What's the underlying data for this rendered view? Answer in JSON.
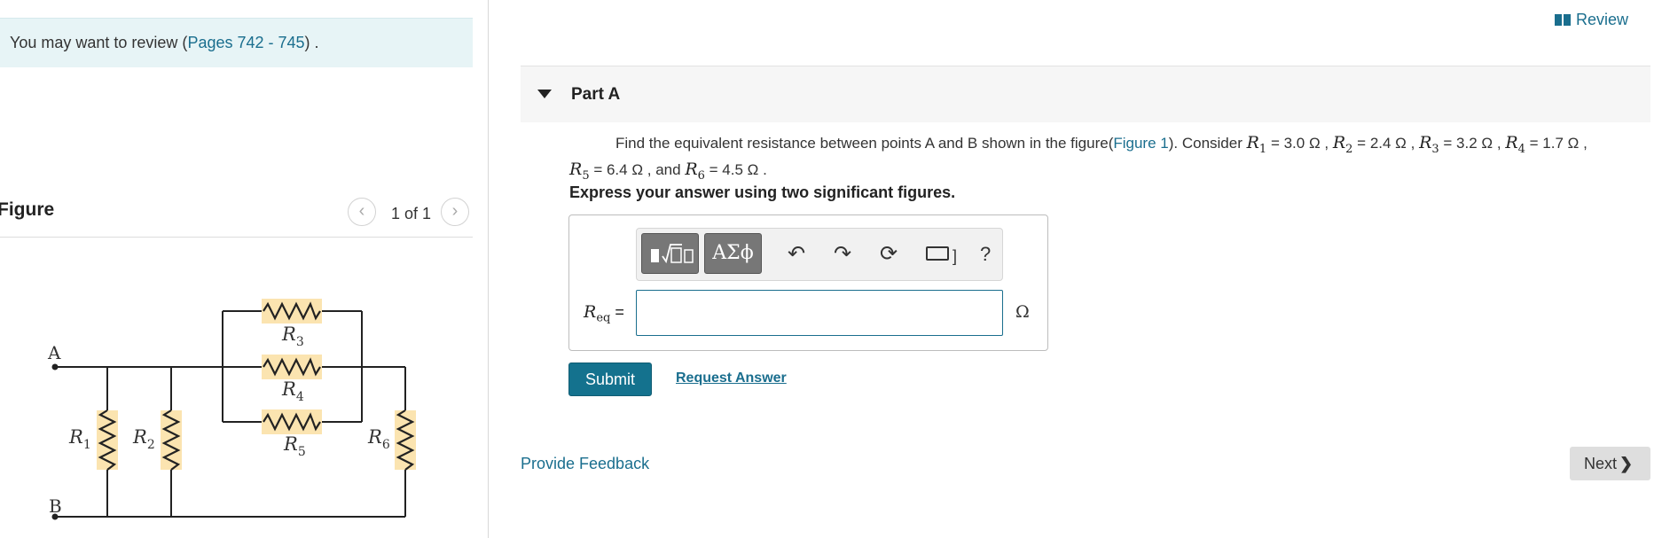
{
  "left": {
    "review_prefix": "You may want to review (",
    "review_link": "Pages 742 - 745",
    "review_suffix": ") .",
    "figure_title": "Figure",
    "pager_text": "1 of 1",
    "pager_prev_icon": "chevron-left-icon",
    "pager_next_icon": "chevron-right-icon",
    "circuit": {
      "node_a": "A",
      "node_b": "B",
      "resistors": [
        "R1",
        "R2",
        "R3",
        "R4",
        "R5",
        "R6"
      ],
      "resistor_letter": "R",
      "subscripts": [
        "1",
        "2",
        "3",
        "4",
        "5",
        "6"
      ],
      "highlight_color": "#fbe4b0"
    }
  },
  "header": {
    "review_label": "Review",
    "review_icon": "book-icon"
  },
  "part": {
    "title": "Part A",
    "question_text": "Find the equivalent resistance between points A and B shown in the figure(",
    "figure_link": "Figure 1",
    "consider": "). Consider",
    "values": [
      {
        "var": "R",
        "sub": "1",
        "text": "= 3.0 Ω ,"
      },
      {
        "var": "R",
        "sub": "2",
        "text": "= 2.4 Ω ,"
      },
      {
        "var": "R",
        "sub": "3",
        "text": "= 3.2 Ω ,"
      },
      {
        "var": "R",
        "sub": "4",
        "text": "= 1.7 Ω ,"
      },
      {
        "var": "R",
        "sub": "5",
        "text": "= 6.4 Ω , and"
      },
      {
        "var": "R",
        "sub": "6",
        "text": "= 4.5 Ω ."
      }
    ],
    "instruction": "Express your answer using two significant figures."
  },
  "answer": {
    "toolbar": {
      "templates_icon": "templates-icon",
      "greek_label": "ΑΣϕ",
      "undo_icon": "undo-icon",
      "redo_icon": "redo-icon",
      "reset_icon": "reset-icon",
      "keyboard_icon": "keyboard-icon",
      "help_label": "?"
    },
    "label_var": "R",
    "label_sub": "eq",
    "label_eq": "=",
    "value": "",
    "unit": "Ω"
  },
  "actions": {
    "submit": "Submit",
    "request_answer": "Request Answer"
  },
  "footer": {
    "feedback": "Provide Feedback",
    "next": "Next",
    "next_icon": "chevron-right-icon"
  },
  "colors": {
    "accent": "#14728e",
    "link": "#1a6e8e",
    "review_bg": "#e7f4f6"
  }
}
